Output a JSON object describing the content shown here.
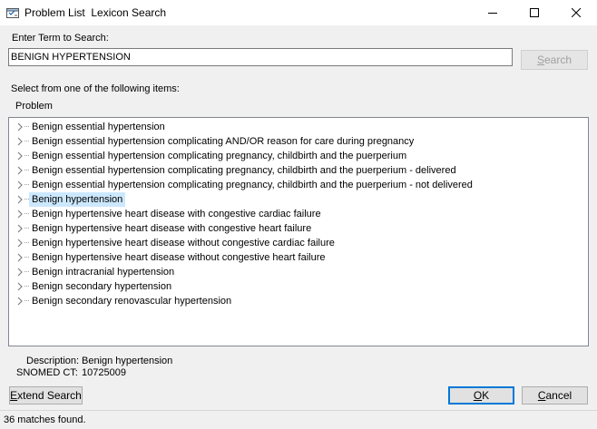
{
  "window": {
    "title": "Problem List  Lexicon Search",
    "controls": [
      "minimize-icon",
      "maximize-icon",
      "close-icon"
    ]
  },
  "search": {
    "label": "Enter Term to Search:",
    "value": "BENIGN HYPERTENSION",
    "button_first": "S",
    "button_rest": "earch"
  },
  "list": {
    "instruction": "Select from one of the following items:",
    "column_header": "Problem",
    "selected_index": 5,
    "items": [
      "Benign essential hypertension",
      "Benign essential hypertension complicating AND/OR reason for care during pregnancy",
      "Benign essential hypertension complicating pregnancy, childbirth and the puerperium",
      "Benign essential hypertension complicating pregnancy, childbirth and the puerperium - delivered",
      "Benign essential hypertension complicating pregnancy, childbirth and the puerperium - not delivered",
      "Benign hypertension",
      "Benign hypertensive heart disease with congestive cardiac failure",
      "Benign hypertensive heart disease with congestive heart failure",
      "Benign hypertensive heart disease without congestive cardiac failure",
      "Benign hypertensive heart disease without congestive heart failure",
      "Benign intracranial hypertension",
      "Benign secondary hypertension",
      "Benign secondary renovascular hypertension"
    ]
  },
  "details": {
    "description_label": "Description:",
    "description_value": "Benign hypertension",
    "snomed_label": "SNOMED CT:",
    "snomed_value": "10725009"
  },
  "buttons": {
    "extend_first": "E",
    "extend_rest": "xtend Search",
    "ok_first": "O",
    "ok_rest": "K",
    "cancel_first": "C",
    "cancel_rest": "ancel"
  },
  "status": {
    "text": "36 matches found."
  },
  "colors": {
    "selection": "#cce8ff",
    "default_button_border": "#0078d7",
    "window_bg": "#f0f0f0"
  }
}
